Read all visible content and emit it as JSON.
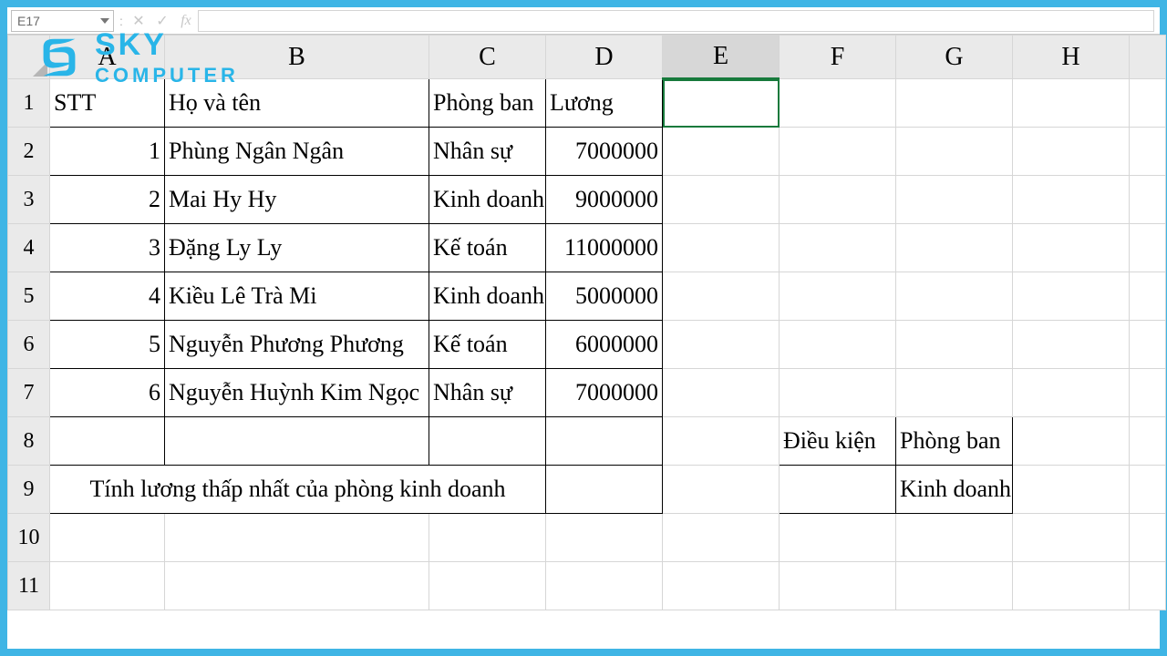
{
  "namebox": {
    "value": "E17"
  },
  "logo": {
    "top": "SKY",
    "bottom": "COMPUTER"
  },
  "columns": [
    "A",
    "B",
    "C",
    "D",
    "E",
    "F",
    "G",
    "H"
  ],
  "selected_column": "E",
  "headers": {
    "A": "STT",
    "B": "Họ và tên",
    "C": "Phòng ban",
    "D": "Lương"
  },
  "rows": [
    {
      "stt": "1",
      "name": "Phùng Ngân Ngân",
      "dept": "Nhân sự",
      "salary": "7000000"
    },
    {
      "stt": "2",
      "name": "Mai Hy Hy",
      "dept": "Kinh doanh",
      "salary": "9000000"
    },
    {
      "stt": "3",
      "name": "Đặng Ly Ly",
      "dept": "Kế toán",
      "salary": "11000000"
    },
    {
      "stt": "4",
      "name": "Kiều Lê Trà Mi",
      "dept": "Kinh doanh",
      "salary": "5000000"
    },
    {
      "stt": "5",
      "name": "Nguyễn Phương Phương",
      "dept": "Kế toán",
      "salary": "6000000"
    },
    {
      "stt": "6",
      "name": "Nguyễn Huỳnh Kim Ngọc",
      "dept": "Nhân sự",
      "salary": "7000000"
    }
  ],
  "row9_label": "Tính lương thấp nhất của phòng kinh doanh",
  "criteria": {
    "F8": "Điều kiện",
    "G8": "Phòng ban",
    "G9": "Kinh doanh"
  },
  "icons": {
    "cancel": "✕",
    "enter": "✓",
    "fx": "fx"
  }
}
